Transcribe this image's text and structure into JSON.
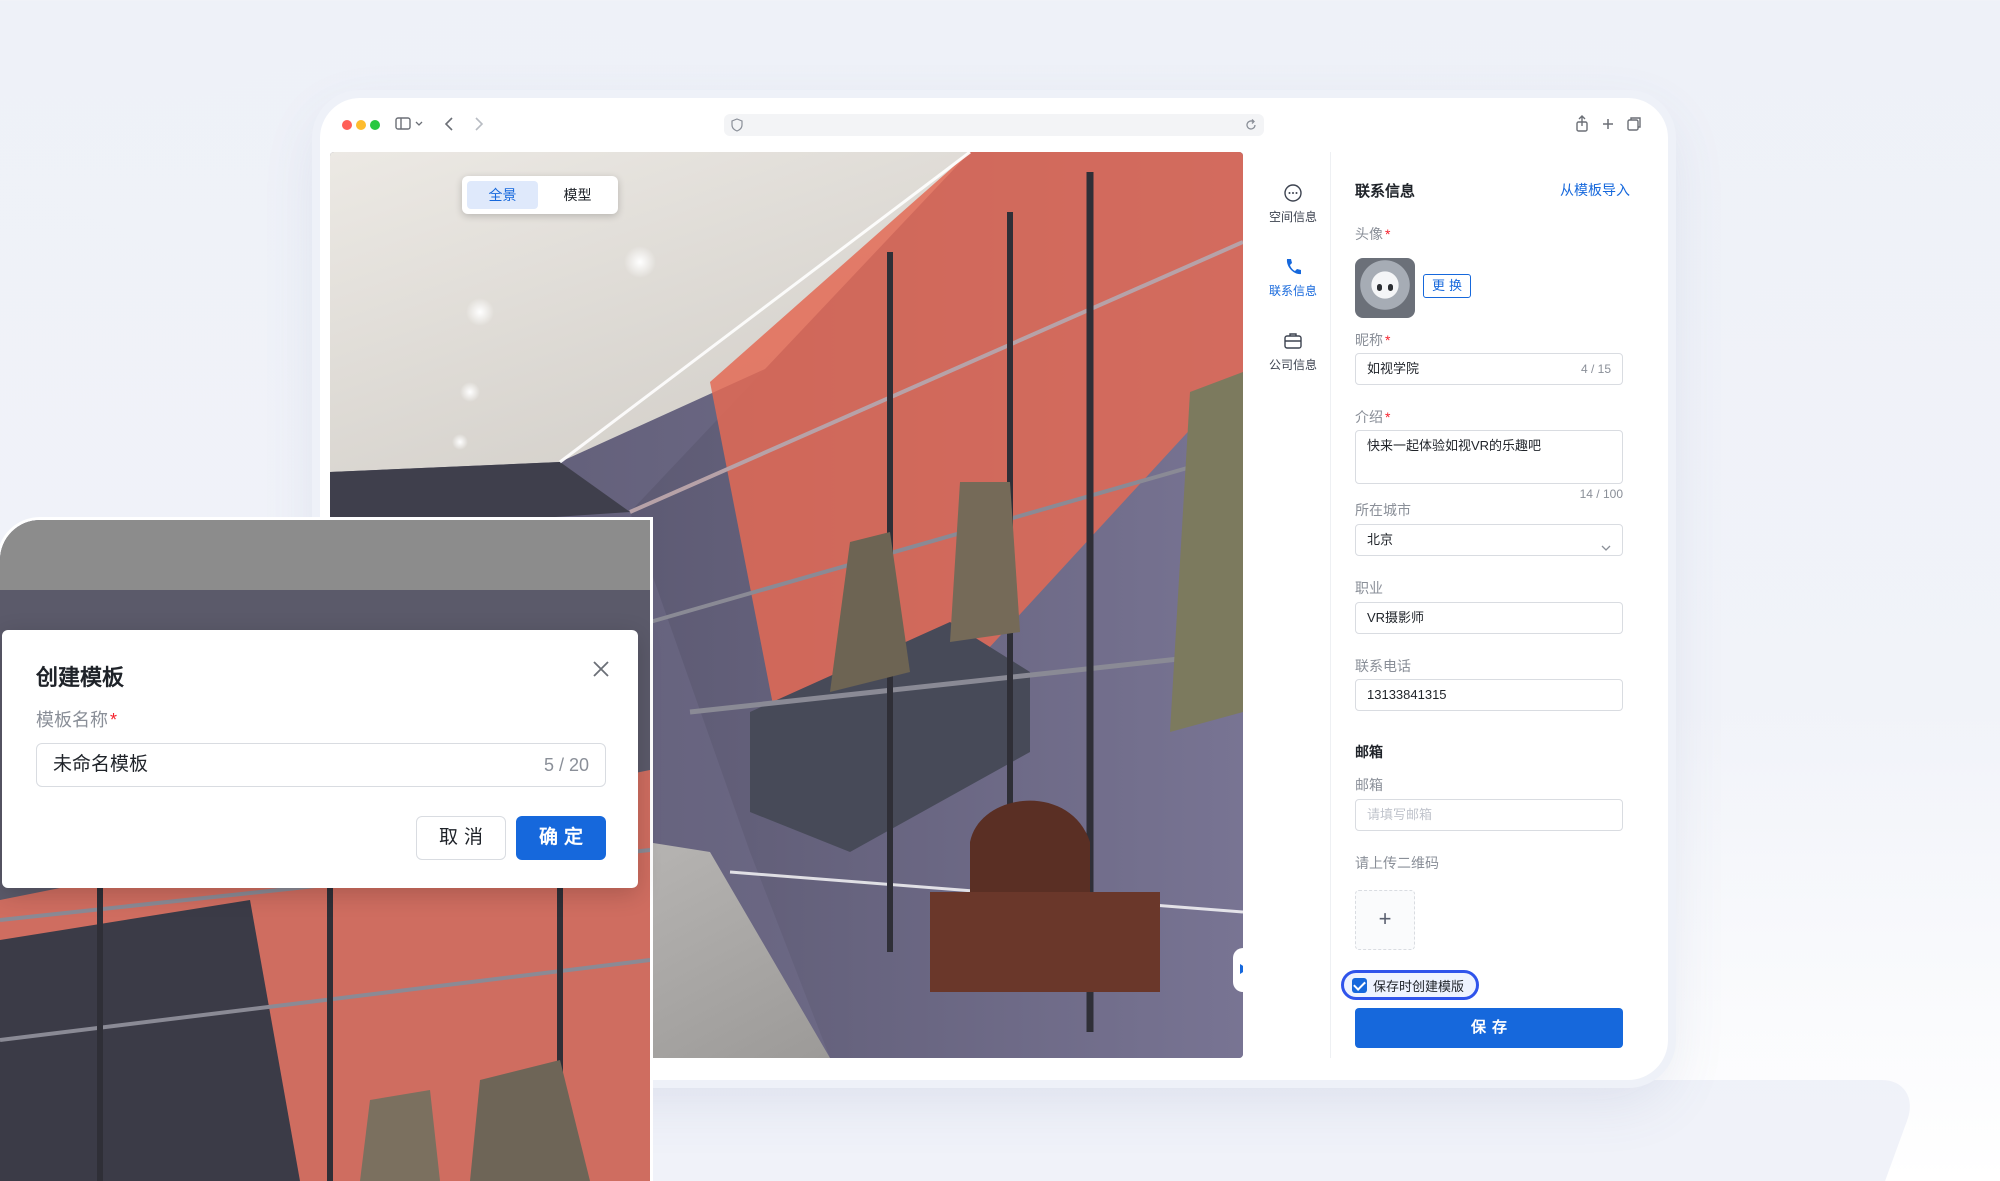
{
  "viewer": {
    "tabs": [
      {
        "label": "全景",
        "active": true
      },
      {
        "label": "模型",
        "active": false
      }
    ]
  },
  "sidenav": {
    "items": [
      {
        "label": "空间信息",
        "icon": "chat-bubble-icon",
        "active": false
      },
      {
        "label": "联系信息",
        "icon": "phone-icon",
        "active": true
      },
      {
        "label": "公司信息",
        "icon": "briefcase-icon",
        "active": false
      }
    ]
  },
  "form": {
    "title": "联系信息",
    "import_link": "从模板导入",
    "avatar": {
      "label": "头像",
      "required": true,
      "change_button": "更换"
    },
    "nickname": {
      "label": "昵称",
      "required": true,
      "value": "如视学院",
      "count": "4 / 15"
    },
    "intro": {
      "label": "介绍",
      "required": true,
      "value": "快来一起体验如视VR的乐趣吧",
      "count": "14 / 100"
    },
    "city": {
      "label": "所在城市",
      "value": "北京"
    },
    "job": {
      "label": "职业",
      "value": "VR摄影师"
    },
    "phone": {
      "label": "联系电话",
      "value": "13133841315"
    },
    "email_section": "邮箱",
    "email": {
      "label": "邮箱",
      "placeholder": "请填写邮箱"
    },
    "qrcode": {
      "label": "请上传二维码"
    },
    "save_template": {
      "label": "保存时创建模版",
      "checked": true
    },
    "save_button": "保存"
  },
  "modal": {
    "title": "创建模板",
    "name_label": "模板名称",
    "name_value": "未命名模板",
    "name_count": "5 / 20",
    "cancel": "取消",
    "confirm": "确定"
  },
  "colors": {
    "primary": "#1668dc",
    "required": "#f5222d",
    "highlight_ring": "#2f54eb"
  }
}
